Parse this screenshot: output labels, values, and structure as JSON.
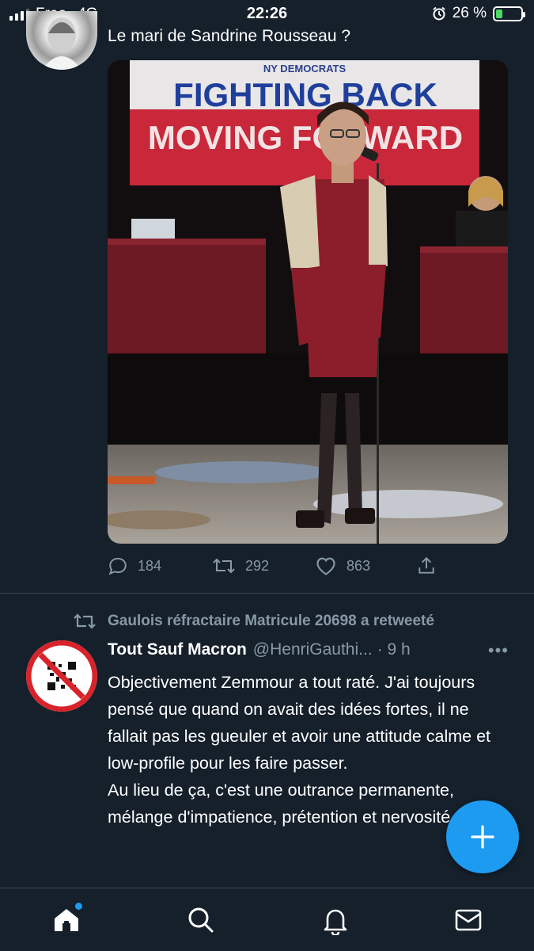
{
  "status_bar": {
    "carrier": "Free",
    "network": "4G",
    "time": "22:26",
    "battery": "26 %",
    "battery_level": 0.26
  },
  "tweet1": {
    "text": "Le mari de Sandrine Rousseau ?",
    "image": {
      "banner_brand": "NY DEMOCRATS",
      "banner_line1": "FIGHTING BACK",
      "banner_line2": "MOVING FORWARD"
    },
    "replies": "184",
    "retweets": "292",
    "likes": "863"
  },
  "tweet2": {
    "retweeted_by": "Gaulois réfractaire Matricule 20698 a retweeté",
    "author_name": "Tout Sauf Macron",
    "author_handle": "@HenriGauthi...",
    "time": "· 9 h",
    "more": "•••",
    "body": "Objectivement Zemmour a tout raté. J'ai toujours pensé que quand on avait des idées fortes, il ne fallait pas les gueuler et avoir une attitude calme et low-profile pour les faire passer.\nAu lieu de ça, c'est une outrance permanente, mélange d'impatience, prétention et nervosité."
  },
  "fab": {
    "icon": "plus-icon"
  },
  "nav": {
    "items": [
      "home-icon",
      "search-icon",
      "bell-icon",
      "mail-icon"
    ]
  },
  "colors": {
    "background": "#15202b",
    "accent": "#1d9bf0",
    "muted": "#8899a6"
  }
}
